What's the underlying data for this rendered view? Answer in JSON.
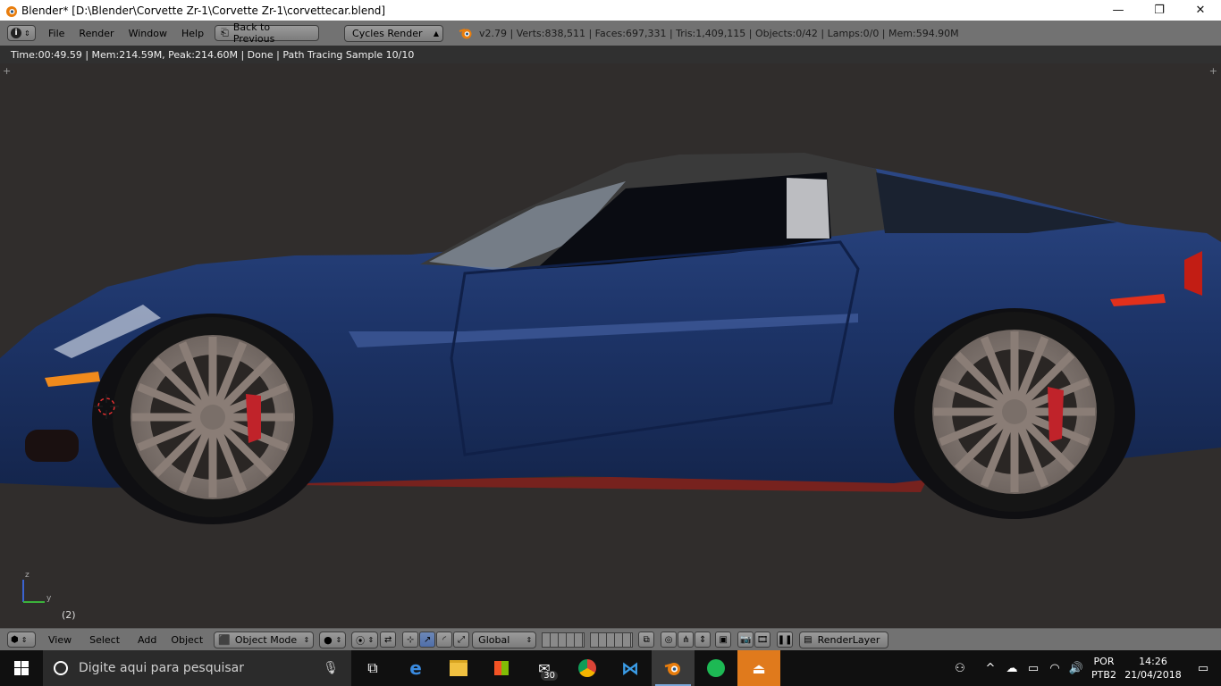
{
  "window": {
    "title": "Blender* [D:\\Blender\\Corvette Zr-1\\Corvette Zr-1\\corvettecar.blend]",
    "minimize_symbol": "—",
    "maximize_symbol": "❐",
    "close_symbol": "✕"
  },
  "info_header": {
    "editor_icon": "info-icon",
    "menus": [
      "File",
      "Render",
      "Window",
      "Help"
    ],
    "back_button": "Back to Previous",
    "render_engine": "Cycles Render",
    "stats": "v2.79 | Verts:838,511 | Faces:697,331 | Tris:1,409,115 | Objects:0/42 | Lamps:0/0 | Mem:594.90M"
  },
  "render_status": "Time:00:49.59 | Mem:214.59M, Peak:214.60M | Done | Path Tracing Sample 10/10",
  "viewport": {
    "frame_label": "(2)",
    "axis_z": "z",
    "axis_y": "y",
    "car_colors": {
      "body": "#1e3566",
      "body_highlight": "#4a66a8",
      "tire": "#141414",
      "rim": "#8a7d76",
      "brake": "#c0232a",
      "indicator": "#f08a1c",
      "taillight": "#e2301c"
    }
  },
  "bottom_header": {
    "menus": [
      "View",
      "Select",
      "Add",
      "Object"
    ],
    "mode": "Object Mode",
    "orientation": "Global",
    "render_layer": "RenderLayer"
  },
  "taskbar": {
    "search_placeholder": "Digite aqui para pesquisar",
    "mail_badge": "30",
    "language": "POR",
    "keyboard": "PTB2",
    "time": "14:26",
    "date": "21/04/2018"
  }
}
